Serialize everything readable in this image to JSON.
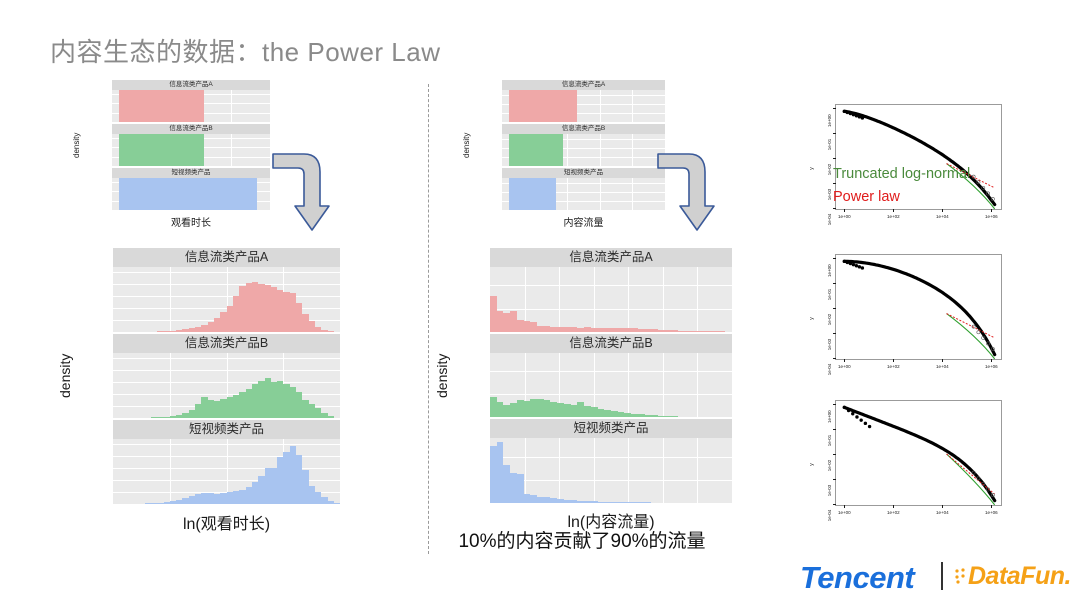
{
  "slide": {
    "title": "内容生态的数据：the Power Law",
    "caption": "10%的内容贡献了90%的流量"
  },
  "logos": {
    "tencent": "Tencent",
    "datafun": "DataFun.",
    "tencent_color": "#1a6fdb",
    "datafun_color": "#f5a117"
  },
  "palette": {
    "series_red": "#efa8a8",
    "series_green": "#87ce97",
    "series_blue": "#a8c4f0",
    "panel_bg": "#eaeaea",
    "strip_bg": "#d9d9d9",
    "gridline": "#ffffff",
    "green_label": "#4a8a3c",
    "red_label": "#e01b1b",
    "arrow_fill": "#d0d0d0",
    "arrow_stroke": "#3b5a99"
  },
  "arrows": [
    {
      "name": "arrow-time-top-to-bottom"
    },
    {
      "name": "arrow-flow-top-to-bottom"
    }
  ],
  "chart_data": [
    {
      "id": "mini_watch_time",
      "type": "bar",
      "title": "",
      "xlabel": "观看时长",
      "ylabel": "density",
      "yticks": [
        "0e+00",
        "1e-07",
        "2e-07",
        "3e-07"
      ],
      "ylim": [
        0,
        3.4e-07
      ],
      "grid": true,
      "facets": [
        {
          "label": "信息流类产品A",
          "color": "#efa8a8",
          "values": [
            0.0,
            0.83,
            0.09,
            0.03,
            0.02,
            0.015,
            0.012,
            0.01,
            0.008,
            0.006,
            0.004,
            0.003,
            0.002,
            0.001,
            0.0,
            0.0,
            0.0,
            0.0,
            0.0,
            0.0,
            0.0,
            0.0,
            0.0,
            0.0
          ]
        },
        {
          "label": "信息流类产品B",
          "color": "#87ce97",
          "values": [
            0.0,
            0.86,
            0.12,
            0.04,
            0.02,
            0.015,
            0.012,
            0.01,
            0.008,
            0.006,
            0.005,
            0.004,
            0.002,
            0.001,
            0.0,
            0.0,
            0.0,
            0.0,
            0.0,
            0.0,
            0.0,
            0.0,
            0.0,
            0.0
          ]
        },
        {
          "label": "短视频类产品",
          "color": "#a8c4f0",
          "values": [
            0.0,
            0.4,
            0.22,
            0.14,
            0.1,
            0.07,
            0.055,
            0.045,
            0.035,
            0.03,
            0.025,
            0.02,
            0.018,
            0.015,
            0.012,
            0.01,
            0.008,
            0.006,
            0.004,
            0.003,
            0.002,
            0.001,
            0.0,
            0.0
          ]
        }
      ]
    },
    {
      "id": "mini_content_flow",
      "type": "bar",
      "title": "",
      "xlabel": "内容流量",
      "ylabel": "density",
      "yticks": [
        "0e+00",
        "2e-06",
        "4e-06",
        "6e-06"
      ],
      "ylim": [
        0,
        7e-06
      ],
      "grid": true,
      "facets": [
        {
          "label": "信息流类产品A",
          "color": "#efa8a8",
          "values": [
            0.0,
            0.93,
            0.05,
            0.02,
            0.01,
            0.008,
            0.005,
            0.004,
            0.003,
            0.002,
            0.001,
            0.0,
            0.0,
            0.0,
            0.0,
            0.0,
            0.0,
            0.0,
            0.0,
            0.0,
            0.0,
            0.0,
            0.0,
            0.0
          ]
        },
        {
          "label": "信息流类产品B",
          "color": "#87ce97",
          "values": [
            0.0,
            0.94,
            0.04,
            0.015,
            0.008,
            0.005,
            0.003,
            0.002,
            0.001,
            0.0,
            0.0,
            0.0,
            0.0,
            0.0,
            0.0,
            0.0,
            0.0,
            0.0,
            0.0,
            0.0,
            0.0,
            0.0,
            0.0,
            0.0
          ]
        },
        {
          "label": "短视频类产品",
          "color": "#a8c4f0",
          "values": [
            0.0,
            0.95,
            0.03,
            0.01,
            0.005,
            0.003,
            0.002,
            0.001,
            0.0,
            0.0,
            0.0,
            0.0,
            0.0,
            0.0,
            0.0,
            0.0,
            0.0,
            0.0,
            0.0,
            0.0,
            0.0,
            0.0,
            0.0,
            0.0
          ]
        }
      ]
    },
    {
      "id": "big_ln_watch_time",
      "type": "bar",
      "title": "",
      "xlabel": "ln(观看时长)",
      "ylabel": "density",
      "yticks": [
        "0.00",
        "0.05",
        "0.10",
        "0.15",
        "0.20",
        "0.25"
      ],
      "ylim": [
        0,
        0.27
      ],
      "grid": true,
      "facets": [
        {
          "label": "信息流类产品A",
          "color": "#efa8a8",
          "values": [
            0.0,
            0.0,
            0.0,
            0.0,
            0.0,
            0.001,
            0.002,
            0.003,
            0.004,
            0.006,
            0.008,
            0.011,
            0.015,
            0.02,
            0.028,
            0.04,
            0.058,
            0.082,
            0.11,
            0.15,
            0.19,
            0.205,
            0.207,
            0.2,
            0.196,
            0.186,
            0.173,
            0.165,
            0.16,
            0.12,
            0.075,
            0.045,
            0.022,
            0.01,
            0.004,
            0.001
          ]
        },
        {
          "label": "信息流类产品B",
          "color": "#87ce97",
          "values": [
            0.0,
            0.0,
            0.001,
            0.001,
            0.002,
            0.002,
            0.003,
            0.004,
            0.005,
            0.008,
            0.012,
            0.02,
            0.035,
            0.06,
            0.086,
            0.075,
            0.07,
            0.08,
            0.086,
            0.095,
            0.108,
            0.122,
            0.14,
            0.152,
            0.165,
            0.15,
            0.155,
            0.14,
            0.128,
            0.108,
            0.075,
            0.06,
            0.04,
            0.022,
            0.008,
            0.002
          ]
        },
        {
          "label": "短视频类产品",
          "color": "#a8c4f0",
          "values": [
            0.0,
            0.0,
            0.001,
            0.001,
            0.002,
            0.003,
            0.004,
            0.006,
            0.008,
            0.012,
            0.018,
            0.026,
            0.035,
            0.042,
            0.046,
            0.046,
            0.042,
            0.044,
            0.048,
            0.052,
            0.06,
            0.072,
            0.09,
            0.115,
            0.15,
            0.15,
            0.195,
            0.215,
            0.24,
            0.205,
            0.14,
            0.075,
            0.05,
            0.03,
            0.013,
            0.004
          ]
        }
      ]
    },
    {
      "id": "big_ln_content_flow",
      "type": "bar",
      "title": "",
      "xlabel": "ln(内容流量)",
      "ylabel": "density",
      "yticks": [
        "0.0",
        "0.2",
        "0.4"
      ],
      "ylim": [
        0,
        0.56
      ],
      "grid": true,
      "facets": [
        {
          "label": "信息流类产品A",
          "color": "#efa8a8",
          "values": [
            0.31,
            0.175,
            0.16,
            0.18,
            0.1,
            0.095,
            0.08,
            0.05,
            0.048,
            0.042,
            0.04,
            0.04,
            0.038,
            0.036,
            0.038,
            0.036,
            0.034,
            0.036,
            0.034,
            0.032,
            0.03,
            0.028,
            0.024,
            0.022,
            0.02,
            0.016,
            0.014,
            0.012,
            0.01,
            0.008,
            0.006,
            0.005,
            0.004,
            0.003,
            0.002,
            0.001
          ]
        },
        {
          "label": "信息流类产品B",
          "color": "#87ce97",
          "values": [
            0.18,
            0.13,
            0.11,
            0.125,
            0.15,
            0.14,
            0.155,
            0.16,
            0.15,
            0.13,
            0.12,
            0.115,
            0.105,
            0.13,
            0.1,
            0.09,
            0.075,
            0.065,
            0.055,
            0.045,
            0.038,
            0.03,
            0.025,
            0.02,
            0.016,
            0.013,
            0.01,
            0.008,
            0.006,
            0.005,
            0.004,
            0.003,
            0.002,
            0.001,
            0.001,
            0.0
          ]
        },
        {
          "label": "短视频类产品",
          "color": "#a8c4f0",
          "values": [
            0.49,
            0.53,
            0.33,
            0.26,
            0.255,
            0.08,
            0.07,
            0.055,
            0.048,
            0.04,
            0.034,
            0.028,
            0.024,
            0.02,
            0.017,
            0.014,
            0.012,
            0.01,
            0.009,
            0.008,
            0.007,
            0.006,
            0.005,
            0.005,
            0.004,
            0.004,
            0.003,
            0.003,
            0.002,
            0.002,
            0.002,
            0.001,
            0.001,
            0.001,
            0.0,
            0.0
          ]
        }
      ]
    },
    {
      "id": "ccdf_1",
      "type": "line",
      "xlabel": "",
      "ylabel": "y",
      "xticks": [
        "1e+00",
        "1e+02",
        "1e+04",
        "1e+06"
      ],
      "yticks": [
        "1e-04",
        "1e-03",
        "1e-02",
        "1e-01",
        "1e+00"
      ],
      "grid": false,
      "legend": [
        {
          "label": "Truncated log-normal",
          "color": "#4a8a3c"
        },
        {
          "label": "Power law",
          "color": "#e01b1b"
        }
      ],
      "series": [
        {
          "name": "empirical",
          "color": "#000000"
        },
        {
          "name": "truncated log-normal fit",
          "color": "#2fa02f"
        },
        {
          "name": "power law fit",
          "color": "#e01b1b"
        }
      ]
    },
    {
      "id": "ccdf_2",
      "type": "line",
      "xlabel": "",
      "ylabel": "y",
      "xticks": [
        "1e+00",
        "1e+02",
        "1e+04",
        "1e+06"
      ],
      "yticks": [
        "1e-04",
        "1e-03",
        "1e-02",
        "1e-01",
        "1e+00"
      ],
      "grid": false,
      "legend": [],
      "series": [
        {
          "name": "empirical",
          "color": "#000000"
        },
        {
          "name": "truncated log-normal fit",
          "color": "#2fa02f"
        },
        {
          "name": "power law fit",
          "color": "#e01b1b"
        }
      ]
    },
    {
      "id": "ccdf_3",
      "type": "line",
      "xlabel": "",
      "ylabel": "y",
      "xticks": [
        "1e+00",
        "1e+02",
        "1e+04",
        "1e+06"
      ],
      "yticks": [
        "1e-04",
        "1e-03",
        "1e-02",
        "1e-01",
        "1e+00"
      ],
      "grid": false,
      "legend": [],
      "series": [
        {
          "name": "empirical",
          "color": "#000000"
        },
        {
          "name": "truncated log-normal fit",
          "color": "#2fa02f"
        },
        {
          "name": "power law fit",
          "color": "#e01b1b"
        }
      ]
    }
  ]
}
